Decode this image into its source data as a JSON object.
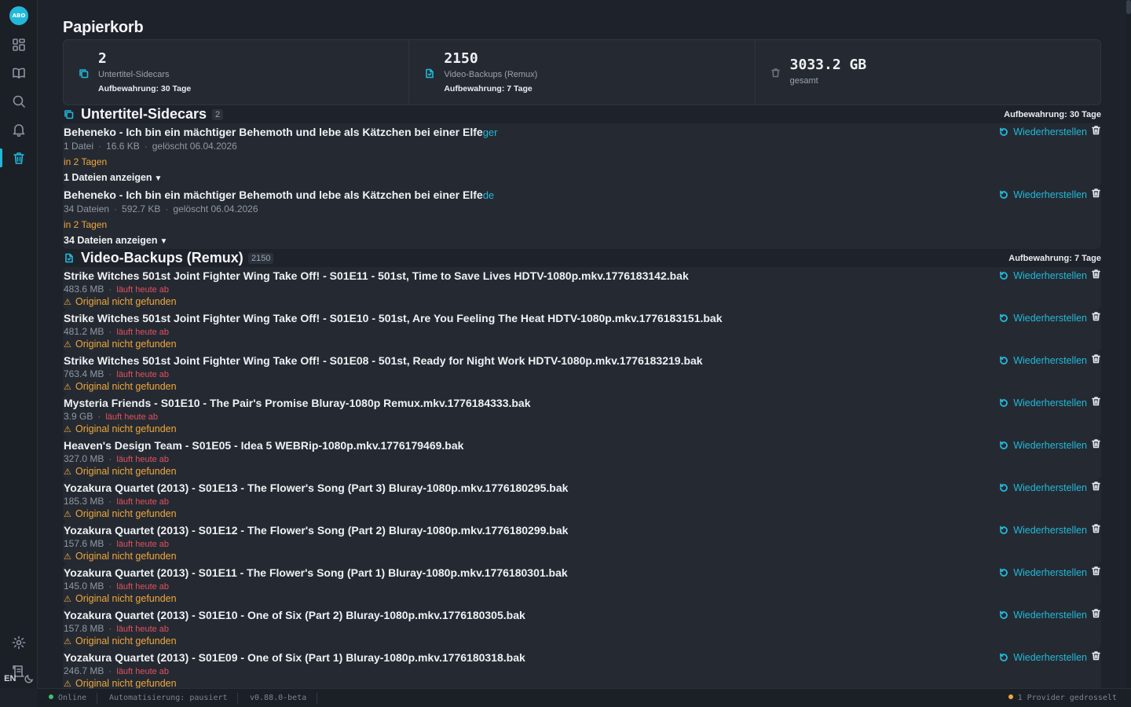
{
  "app": {
    "logo_text": "ABO"
  },
  "sidebar": {
    "items": [
      {
        "name": "dashboard",
        "icon": "grid-icon"
      },
      {
        "name": "library",
        "icon": "book-icon"
      },
      {
        "name": "search",
        "icon": "search-icon"
      },
      {
        "name": "notifications",
        "icon": "bell-icon"
      },
      {
        "name": "trash",
        "icon": "trash-icon",
        "active": true
      }
    ],
    "bottom": [
      {
        "name": "settings",
        "icon": "gear-icon"
      },
      {
        "name": "logs",
        "icon": "scroll-icon"
      }
    ],
    "lang": "EN"
  },
  "page": {
    "title": "Papierkorb"
  },
  "stats": [
    {
      "value": "2",
      "label": "Untertitel-Sidecars",
      "retention": "Aufbewahrung: 30 Tage",
      "icon": "copy-icon"
    },
    {
      "value": "2150",
      "label": "Video-Backups (Remux)",
      "retention": "Aufbewahrung: 7 Tage",
      "icon": "file-icon"
    },
    {
      "value": "3033.2 GB",
      "label": "gesamt",
      "retention": "",
      "icon": "trash-icon"
    }
  ],
  "sections": {
    "subs": {
      "title": "Untertitel-Sidecars",
      "count": "2",
      "retention": "Aufbewahrung: 30 Tage",
      "items": [
        {
          "name": "Beheneko - Ich bin ein mächtiger Behemoth und lebe als Kätzchen bei einer Elfe",
          "lang": "ger",
          "files": "1 Datei",
          "size": "16.6 KB",
          "deleted": "gelöscht 06.04.2026",
          "expires": "in 2 Tagen",
          "toggle": "1 Dateien anzeigen"
        },
        {
          "name": "Beheneko - Ich bin ein mächtiger Behemoth und lebe als Kätzchen bei einer Elfe",
          "lang": "de",
          "files": "34 Dateien",
          "size": "592.7 KB",
          "deleted": "gelöscht 06.04.2026",
          "expires": "in 2 Tagen",
          "toggle": "34 Dateien anzeigen"
        }
      ]
    },
    "videos": {
      "title": "Video-Backups (Remux)",
      "count": "2150",
      "retention": "Aufbewahrung: 7 Tage",
      "items": [
        {
          "name": "Strike Witches 501st Joint Fighter Wing Take Off! - S01E11 - 501st, Time to Save Lives HDTV-1080p.mkv.1776183142.bak",
          "size": "483.6 MB",
          "expires": "läuft heute ab",
          "warning": "Original nicht gefunden"
        },
        {
          "name": "Strike Witches 501st Joint Fighter Wing Take Off! - S01E10 - 501st, Are You Feeling The Heat HDTV-1080p.mkv.1776183151.bak",
          "size": "481.2 MB",
          "expires": "läuft heute ab",
          "warning": "Original nicht gefunden"
        },
        {
          "name": "Strike Witches 501st Joint Fighter Wing Take Off! - S01E08 - 501st, Ready for Night Work HDTV-1080p.mkv.1776183219.bak",
          "size": "763.4 MB",
          "expires": "läuft heute ab",
          "warning": "Original nicht gefunden"
        },
        {
          "name": "Mysteria Friends - S01E10 - The Pair's Promise Bluray-1080p Remux.mkv.1776184333.bak",
          "size": "3.9 GB",
          "expires": "läuft heute ab",
          "warning": "Original nicht gefunden"
        },
        {
          "name": "Heaven's Design Team - S01E05 - Idea 5 WEBRip-1080p.mkv.1776179469.bak",
          "size": "327.0 MB",
          "expires": "läuft heute ab",
          "warning": "Original nicht gefunden"
        },
        {
          "name": "Yozakura Quartet (2013) - S01E13 - The Flower's Song (Part 3) Bluray-1080p.mkv.1776180295.bak",
          "size": "185.3 MB",
          "expires": "läuft heute ab",
          "warning": "Original nicht gefunden"
        },
        {
          "name": "Yozakura Quartet (2013) - S01E12 - The Flower's Song (Part 2) Bluray-1080p.mkv.1776180299.bak",
          "size": "157.6 MB",
          "expires": "läuft heute ab",
          "warning": "Original nicht gefunden"
        },
        {
          "name": "Yozakura Quartet (2013) - S01E11 - The Flower's Song (Part 1) Bluray-1080p.mkv.1776180301.bak",
          "size": "145.0 MB",
          "expires": "läuft heute ab",
          "warning": "Original nicht gefunden"
        },
        {
          "name": "Yozakura Quartet (2013) - S01E10 - One of Six (Part 2) Bluray-1080p.mkv.1776180305.bak",
          "size": "157.8 MB",
          "expires": "läuft heute ab",
          "warning": "Original nicht gefunden"
        },
        {
          "name": "Yozakura Quartet (2013) - S01E09 - One of Six (Part 1) Bluray-1080p.mkv.1776180318.bak",
          "size": "246.7 MB",
          "expires": "läuft heute ab",
          "warning": "Original nicht gefunden"
        }
      ]
    }
  },
  "actions": {
    "restore_label": "Wiederherstellen"
  },
  "statusbar": {
    "online": "Online",
    "automation": "Automatisierung: pausiert",
    "version": "v0.88.0-beta",
    "providers": "1 Provider gedrosselt"
  },
  "colors": {
    "accent": "#22b8d9",
    "warning": "#f0a73c",
    "danger": "#e0505f",
    "online": "#3fbf6f"
  }
}
